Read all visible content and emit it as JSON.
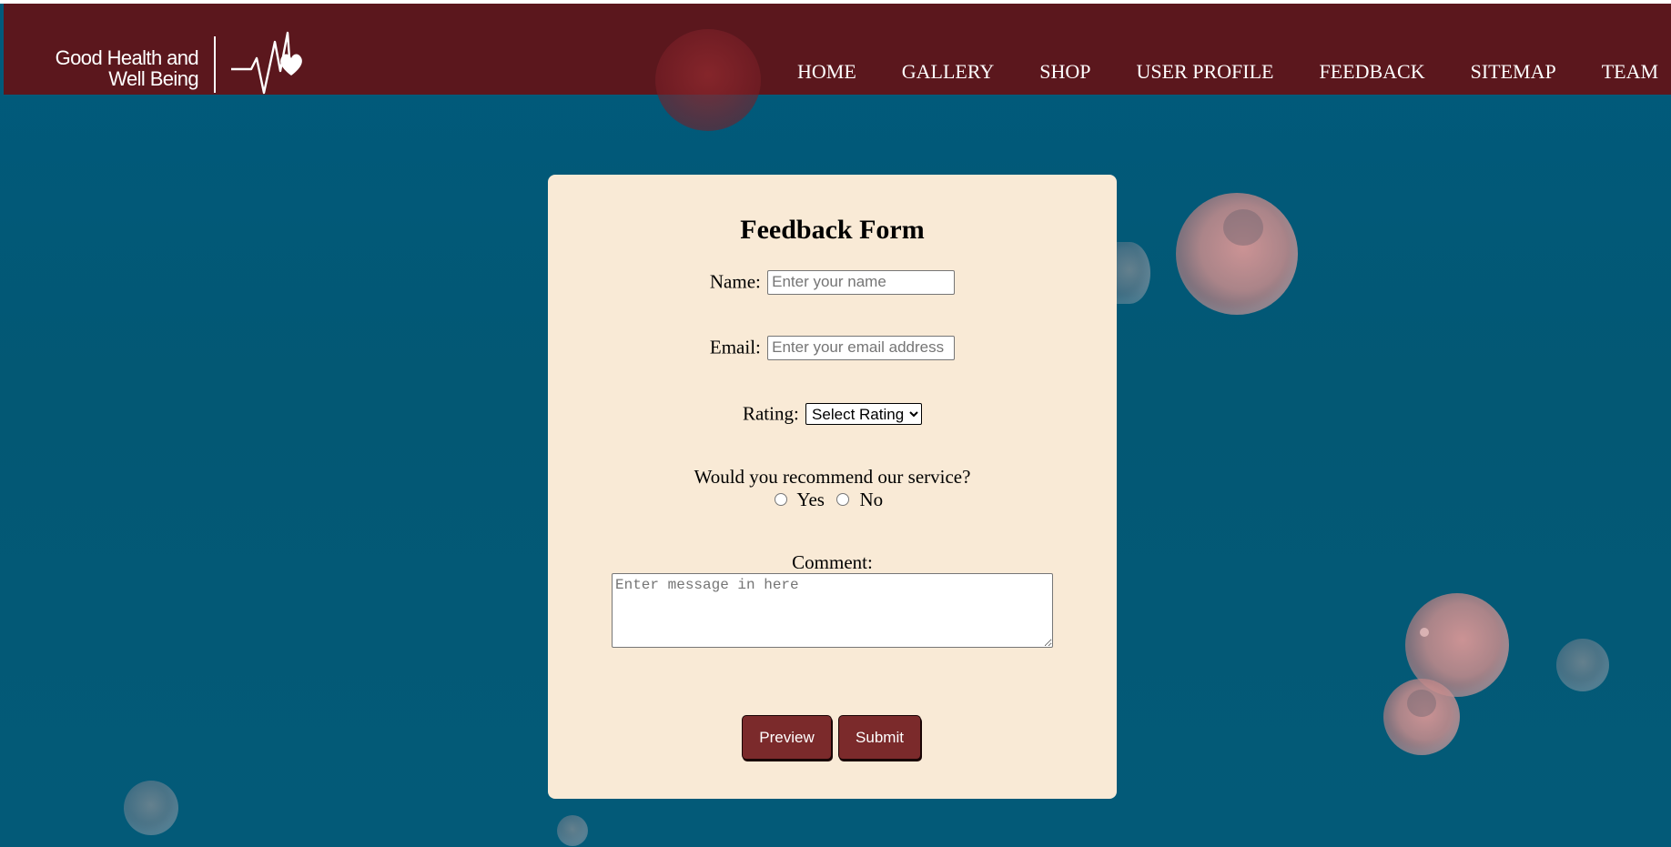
{
  "brand": {
    "line1": "Good Health and",
    "line2": "Well Being"
  },
  "nav": {
    "items": [
      {
        "label": "HOME"
      },
      {
        "label": "GALLERY"
      },
      {
        "label": "SHOP"
      },
      {
        "label": "USER PROFILE"
      },
      {
        "label": "FEEDBACK"
      },
      {
        "label": "SITEMAP"
      },
      {
        "label": "TEAM"
      }
    ]
  },
  "form": {
    "title": "Feedback Form",
    "name_label": "Name:",
    "name_placeholder": "Enter your name",
    "name_value": "",
    "email_label": "Email:",
    "email_placeholder": "Enter your email address",
    "email_value": "",
    "rating_label": "Rating:",
    "rating_selected": "Select Rating",
    "recommend_question": "Would you recommend our service?",
    "recommend_yes": "Yes",
    "recommend_no": "No",
    "comment_label": "Comment:",
    "comment_placeholder": "Enter message in here",
    "comment_value": "",
    "preview_label": "Preview",
    "submit_label": "Submit"
  },
  "icons": {
    "logo": "heartbeat-heart-icon",
    "select_arrow": "chevron-down-icon",
    "resize_handle": "resize-grip-icon"
  },
  "colors": {
    "header_bg": "#5b171d",
    "page_bg": "#035874",
    "card_bg": "#f9ead6",
    "button_bg": "#7b2a2b",
    "nav_text": "#ffffff"
  }
}
